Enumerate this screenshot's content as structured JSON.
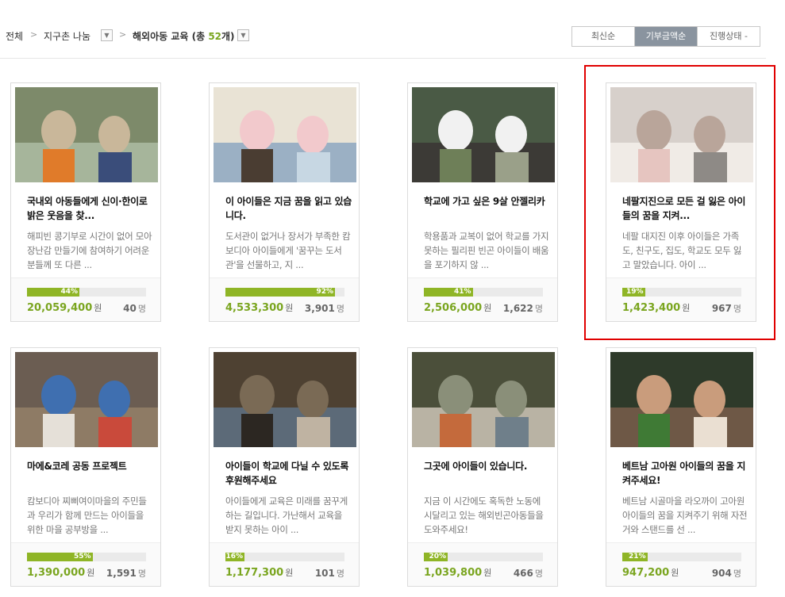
{
  "breadcrumb": {
    "root": "전체",
    "level1": "지구촌 나눔",
    "level2_prefix": "해외아동 교육 (총 ",
    "level2_count": "52",
    "level2_suffix": "개)"
  },
  "sort": {
    "options": [
      "최신순",
      "기부금액순",
      "진행상태 -"
    ],
    "active": "기부금액순"
  },
  "cards": [
    {
      "title": "국내외 아동들에게 신이·한이로 밝은 웃음을 찾...",
      "desc": "해피빈 콩기부로 시간이 없어 모아장난감 만들기에 참여하기 어려운 분들께 또 다른 ...",
      "percent_label": "44%",
      "percent": 44,
      "amount": "20,059,400",
      "won": "원",
      "people": "40",
      "people_unit": "명",
      "image": "children-group-photo"
    },
    {
      "title": "이 아이들은 지금 꿈을 읽고 있습니다.",
      "desc": "도서관이 없거나 장서가 부족한 캄보디아 아이들에게 '꿈꾸는 도서관'을 선물하고, 지 ...",
      "percent_label": "92%",
      "percent": 92,
      "amount": "4,533,300",
      "won": "원",
      "people": "3,901",
      "people_unit": "명",
      "image": "children-reading-photo"
    },
    {
      "title": "학교에 가고 싶은 9살 안젤리카",
      "desc": "학용품과 교복이 없어 학교를 가지 못하는 필리핀 빈곤 아이들이 배움을 포기하지 않 ...",
      "percent_label": "41%",
      "percent": 41,
      "amount": "2,506,000",
      "won": "원",
      "people": "1,622",
      "people_unit": "명",
      "image": "girl-portrait-photo"
    },
    {
      "title": "네팔지진으로 모든 걸 잃은 아이들의 꿈을 지켜...",
      "desc": "네팔 대지진 이후 아이들은 가족도, 친구도, 집도, 학교도 모두 잃고 말았습니다. 아이 ...",
      "percent_label": "19%",
      "percent": 19,
      "amount": "1,423,400",
      "won": "원",
      "people": "967",
      "people_unit": "명",
      "image": "child-behind-fence-photo"
    },
    {
      "title": "마에&코레 공동 프로젝트",
      "desc": "캄보디아 찌삐여이마을의 주민들과 우리가 함께 만드는 아이들을 위한 마을 공부방을 ...",
      "percent_label": "55%",
      "percent": 55,
      "amount": "1,390,000",
      "won": "원",
      "people": "1,591",
      "people_unit": "명",
      "image": "children-studying-photo"
    },
    {
      "title": "아이들이 학교에 다닐 수 있도록 후원해주세요",
      "desc": "아이들에게 교육은 미래를 꿈꾸게 하는 길입니다. 가난해서 교육을 받지 못하는 아이 ...",
      "percent_label": "16%",
      "percent": 16,
      "amount": "1,177,300",
      "won": "원",
      "people": "101",
      "people_unit": "명",
      "image": "boy-reading-photo"
    },
    {
      "title": "그곳에 아이들이 있습니다.",
      "desc": "지금 이 시간에도 혹독한 노동에 시달리고 있는 해외빈곤아동들을 도와주세요!",
      "percent_label": "20%",
      "percent": 20,
      "amount": "1,039,800",
      "won": "원",
      "people": "466",
      "people_unit": "명",
      "image": "girl-at-dump-photo"
    },
    {
      "title": "베트남 고아원 아이들의 꿈을 지켜주세요!",
      "desc": "베트남 시골마을 라오까이 고아원 아이들의 꿈을 지켜주기 위해 자전거와 스탠드를 선 ...",
      "percent_label": "21%",
      "percent": 21,
      "amount": "947,200",
      "won": "원",
      "people": "904",
      "people_unit": "명",
      "image": "two-boys-photo"
    }
  ],
  "colors": {
    "accent": "#7aa51f",
    "progress": "#8fb526",
    "highlight": "#e00000"
  }
}
